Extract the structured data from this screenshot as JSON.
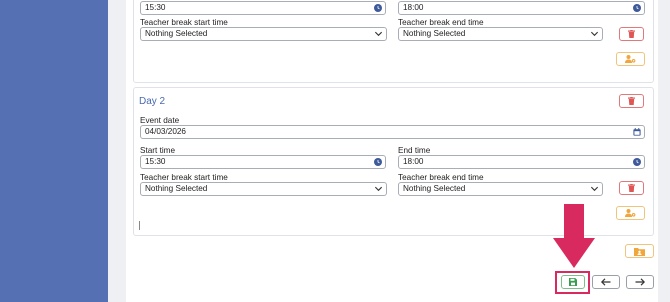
{
  "day1": {
    "start_time": "15:30",
    "end_time": "18:00",
    "break_start_label": "Teacher break start time",
    "break_end_label": "Teacher break end time",
    "break_start_value": "Nothing Selected",
    "break_end_value": "Nothing Selected"
  },
  "day2": {
    "title": "Day 2",
    "event_date_label": "Event date",
    "event_date": "04/03/2026",
    "start_time_label": "Start time",
    "start_time": "15:30",
    "end_time_label": "End time",
    "end_time": "18:00",
    "break_start_label": "Teacher break start time",
    "break_end_label": "Teacher break end time",
    "break_start_value": "Nothing Selected",
    "break_end_value": "Nothing Selected"
  },
  "colors": {
    "sidebar": "#5670b4",
    "delete": "#e05656",
    "warning": "#f0a63c",
    "save": "#3a9d52",
    "highlight": "#d82a5e",
    "title": "#4a6ab0"
  },
  "icons": [
    "clock-icon",
    "chevron-down-icon",
    "calendar-icon",
    "trash-icon",
    "user-cog-icon",
    "folder-users-icon",
    "save-icon",
    "arrow-left-icon",
    "arrow-right-icon"
  ]
}
